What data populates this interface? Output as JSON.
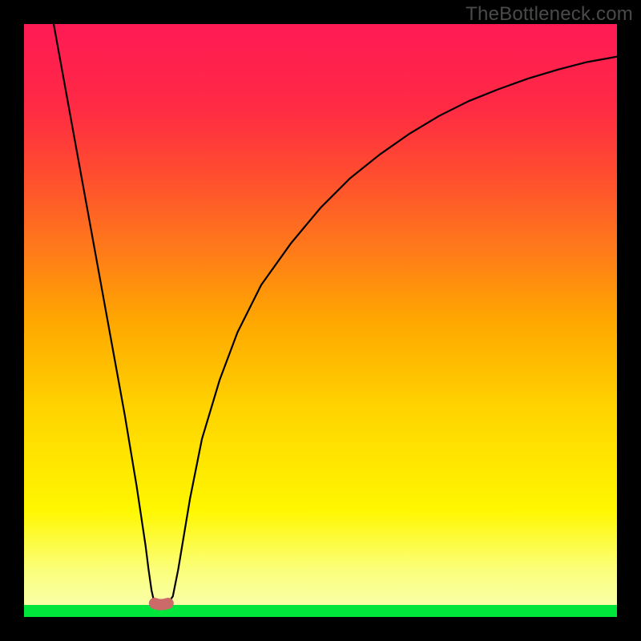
{
  "watermark": "TheBottleneck.com",
  "colors": {
    "frame": "#000000",
    "gradient_top": "#ff1a55",
    "gradient_mid": "#fff700",
    "gradient_bottom": "#00e63b",
    "curve": "#000000",
    "bump": "#cc6a6a"
  },
  "chart_data": {
    "type": "line",
    "title": "",
    "xlabel": "",
    "ylabel": "",
    "xlim": [
      0,
      100
    ],
    "ylim": [
      0,
      100
    ],
    "grid": false,
    "x": [
      5,
      7,
      9,
      11,
      13,
      15,
      17,
      19,
      20.5,
      21,
      21.5,
      22,
      22.7,
      23.5,
      24.3,
      25.1,
      26,
      28,
      30,
      33,
      36,
      40,
      45,
      50,
      55,
      60,
      65,
      70,
      75,
      80,
      85,
      90,
      95,
      100
    ],
    "series": [
      {
        "name": "bottleneck-curve",
        "values": [
          100,
          89,
          78,
          67,
          56,
          45,
          34,
          22,
          12,
          8,
          4.5,
          2.3,
          2.1,
          2.1,
          2.3,
          3.5,
          8,
          20,
          30,
          40,
          48,
          56,
          63,
          69,
          74,
          78,
          81.5,
          84.5,
          87,
          89,
          90.8,
          92.3,
          93.6,
          94.5
        ]
      },
      {
        "name": "sweet-spot-marker",
        "values": [
          null,
          null,
          null,
          null,
          null,
          null,
          null,
          null,
          null,
          null,
          null,
          2.3,
          2.1,
          2.1,
          2.3,
          null,
          null,
          null,
          null,
          null,
          null,
          null,
          null,
          null,
          null,
          null,
          null,
          null,
          null,
          null,
          null,
          null,
          null,
          null
        ]
      }
    ],
    "annotations": []
  }
}
